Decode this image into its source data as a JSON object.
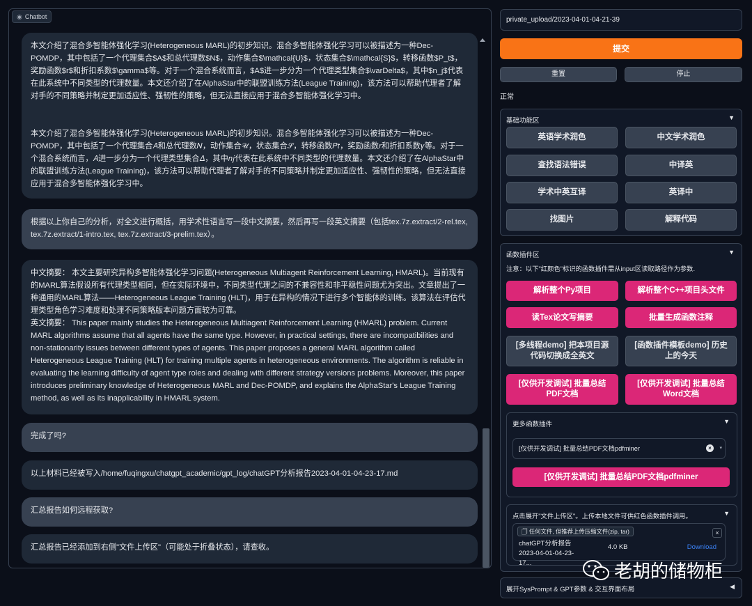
{
  "chatbot": {
    "label": "Chatbot",
    "messages": [
      {
        "role": "bot",
        "paragraphs": [
          "本文介绍了混合多智能体强化学习(Heterogeneous MARL)的初步知识。混合多智能体强化学习可以被描述为一种Dec-POMDP，其中包括了一个代理集合$A$和总代理数$N$，动作集合$\\mathcal{U}$，状态集合$\\mathcal{S}$，转移函数$P_t$，奖励函数$r$和折扣系数$\\gamma$等。对于一个混合系统而言，$A$进一步分为一个代理类型集合$\\varDelta$，其中$n_j$代表在此系统中不同类型的代理数量。本文还介绍了在AlphaStar中的联盟训练方法(League Training)，该方法可以帮助代理者了解对手的不同策略并制定更加适应性、强韧性的策略，但无法直接应用于混合多智能体强化学习中。",
          "本文介绍了混合多智能体强化学习(Heterogeneous MARL)的初步知识。混合多智能体强化学习可以被描述为一种Dec-POMDP，其中包括了一个代理集合𝐴和总代理数𝑁，动作集合𝒰，状态集合𝒮，转移函数𝑃𝑡，奖励函数𝑟和折扣系数𝛾等。对于一个混合系统而言，𝐴进一步分为一个代理类型集合𝛥，其中𝑛𝑗代表在此系统中不同类型的代理数量。本文还介绍了在AlphaStar中的联盟训练方法(League Training)，该方法可以帮助代理者了解对手的不同策略并制定更加适应性、强韧性的策略，但无法直接应用于混合多智能体强化学习中。"
        ]
      },
      {
        "role": "user",
        "paragraphs": [
          "根据以上你自己的分析，对全文进行概括，用学术性语言写一段中文摘要，然后再写一段英文摘要（包括tex.7z.extract/2-rel.tex, tex.7z.extract/1-intro.tex, tex.7z.extract/3-prelim.tex）。"
        ]
      },
      {
        "role": "bot",
        "paragraphs": [
          "中文摘要： 本文主要研究异构多智能体强化学习问题(Heterogeneous Multiagent Reinforcement Learning, HMARL)。当前现有的MARL算法假设所有代理类型相同，但在实际环境中，不同类型代理之间的不兼容性和非平稳性问题尤为突出。文章提出了一种通用的MARL算法——Heterogeneous League Training (HLT)，用于在异构的情况下进行多个智能体的训练。该算法在评估代理类型角色学习难度和处理不同策略版本问题方面较为可靠。",
          "英文摘要： This paper mainly studies the Heterogeneous Multiagent Reinforcement Learning (HMARL) problem. Current MARL algorithms assume that all agents have the same type. However, in practical settings, there are incompatibilities and non-stationarity issues between different types of agents. This paper proposes a general MARL algorithm called Heterogeneous League Training (HLT) for training multiple agents in heterogeneous environments. The algorithm is reliable in evaluating the learning difficulty of agent type roles and dealing with different strategy versions problems. Moreover, this paper introduces preliminary knowledge of Heterogeneous MARL and Dec-POMDP, and explains the AlphaStar's League Training method, as well as its inapplicability in HMARL system."
        ]
      },
      {
        "role": "user",
        "paragraphs": [
          "完成了吗?"
        ]
      },
      {
        "role": "bot",
        "paragraphs": [
          "以上材料已经被写入/home/fuqingxu/chatgpt_academic/gpt_log/chatGPT分析报告2023-04-01-04-23-17.md"
        ]
      },
      {
        "role": "user",
        "paragraphs": [
          "汇总报告如何远程获取?"
        ]
      },
      {
        "role": "bot",
        "paragraphs": [
          "汇总报告已经添加到右侧\"文件上传区\"（可能处于折叠状态），请查收。"
        ]
      }
    ]
  },
  "input": {
    "value": "private_upload/2023-04-01-04-21-39"
  },
  "buttons": {
    "submit": "提交",
    "reset": "重置",
    "stop": "停止"
  },
  "status": "正常",
  "basic": {
    "title": "基础功能区",
    "arrow": "▼",
    "items": [
      "英语学术润色",
      "中文学术润色",
      "查找语法错误",
      "中译英",
      "学术中英互译",
      "英译中",
      "找图片",
      "解释代码"
    ]
  },
  "plugins": {
    "title": "函数插件区",
    "arrow": "▼",
    "note": "注意：以下\"红颜色\"标识的函数插件需从input区读取路径作为参数.",
    "items": [
      "解析整个Py项目",
      "解析整个C++项目头文件",
      "读Tex论文写摘要",
      "批量生成函数注释",
      "[多线程demo] 把本项目源代码切换成全英文",
      "[函数插件模板demo] 历史上的今天",
      "[仅供开发调试] 批量总结PDF文档",
      "[仅供开发调试] 批量总结Word文档"
    ],
    "more": {
      "title": "更多函数插件",
      "arrow": "▼",
      "selected": "[仅供开发调试] 批量总结PDF文档pdfminer",
      "clear": "×",
      "caret": "▾",
      "run": "[仅供开发调试] 批量总结PDF文档pdfminer"
    }
  },
  "upload": {
    "title": "点击展开\"文件上传区\"。上传本地文件可供红色函数插件调用。",
    "arrow": "▼",
    "tag": "任何文件, 但推荐上传压缩文件(zip, tar)",
    "close": "×",
    "file_name": "chatGPT分析报告2023-04-01-04-23-17...",
    "file_size": "4.0 KB",
    "download": "Download"
  },
  "sysprompt": {
    "title": "展开SysPrompt & GPT参数 & 交互界面布局",
    "arrow": "◀"
  },
  "watermark": {
    "text": "老胡的储物柜"
  },
  "colors": {
    "accent": "#f97316",
    "plugin": "#db2777",
    "link": "#3b82f6",
    "bg": "#0b0f19"
  }
}
